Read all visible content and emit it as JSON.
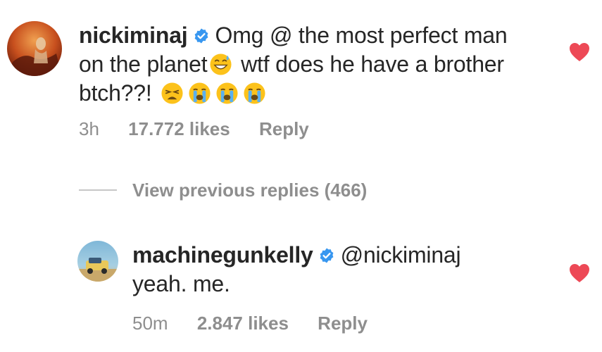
{
  "colors": {
    "text": "#262626",
    "secondary": "#8e8e8e",
    "verified": "#3897f0",
    "heart": "#ed4956"
  },
  "comment": {
    "username": "nickiminaj",
    "verified_icon": "verified-badge-icon",
    "text_part1": "Omg @ the most perfect man on the planet",
    "emoji_1": "grinning-sweat-emoji",
    "text_part2": " wtf does he have a brother btch??!",
    "emoji_2": "weary-face-emoji",
    "emoji_3": "loudly-crying-face-emoji",
    "emoji_4": "loudly-crying-face-emoji",
    "time": "3h",
    "likes": "17.772 likes",
    "reply_label": "Reply",
    "like_icon": "heart-filled-icon"
  },
  "view_previous": {
    "label": "View previous replies (466)"
  },
  "reply": {
    "username": "machinegunkelly",
    "verified_icon": "verified-badge-icon",
    "mention": "@nickiminaj",
    "text": "yeah. me.",
    "time": "50m",
    "likes": "2.847 likes",
    "reply_label": "Reply",
    "like_icon": "heart-filled-icon"
  }
}
